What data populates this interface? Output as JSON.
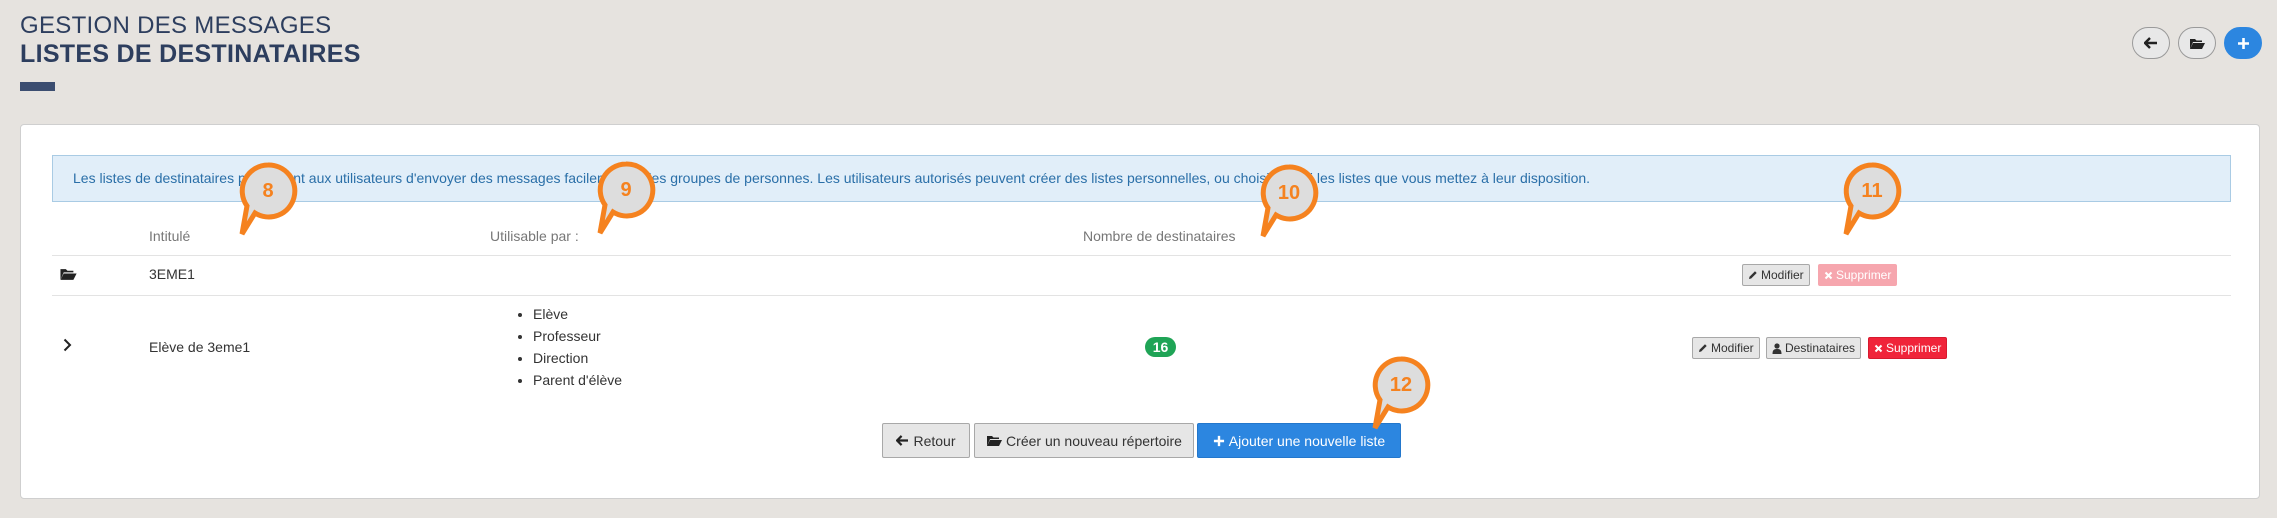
{
  "header": {
    "subtitle": "GESTION DES MESSAGES",
    "title": "LISTES DE DESTINATAIRES"
  },
  "top_buttons": [
    {
      "icon": "arrow-left-icon"
    },
    {
      "icon": "folder-open-icon"
    },
    {
      "icon": "plus-icon"
    }
  ],
  "info_text": "Les listes de destinataires permettent aux utilisateurs d'envoyer des messages facilement à des groupes de personnes. Les utilisateurs autorisés peuvent créer des listes personnelles, ou choisir parmi les listes que vous mettez à leur disposition.",
  "table": {
    "columns": [
      "Intitulé",
      "Utilisable par :",
      "Nombre de destinataires"
    ],
    "rows": [
      {
        "type": "folder",
        "icon": "folder-open-icon",
        "name": "3EME1",
        "actions": {
          "modify": "Modifier",
          "delete": "Supprimer",
          "delete_disabled": true
        }
      },
      {
        "type": "list",
        "icon": "chevron-right-icon",
        "name": "Elève de 3eme1",
        "users": [
          "Elève",
          "Professeur",
          "Direction",
          "Parent d'élève"
        ],
        "count": "16",
        "actions": {
          "modify": "Modifier",
          "recipients": "Destinataires",
          "delete": "Supprimer"
        }
      }
    ]
  },
  "footer": {
    "back": "Retour",
    "new_folder": "Créer un nouveau répertoire",
    "add_list": "Ajouter une nouvelle liste"
  },
  "markers": [
    "8",
    "9",
    "10",
    "11",
    "12"
  ],
  "colors": {
    "primary": "#2c86e0",
    "danger": "#f0243a",
    "success": "#1fa456",
    "heading": "#2d3e5e",
    "marker": "#f5821f"
  }
}
